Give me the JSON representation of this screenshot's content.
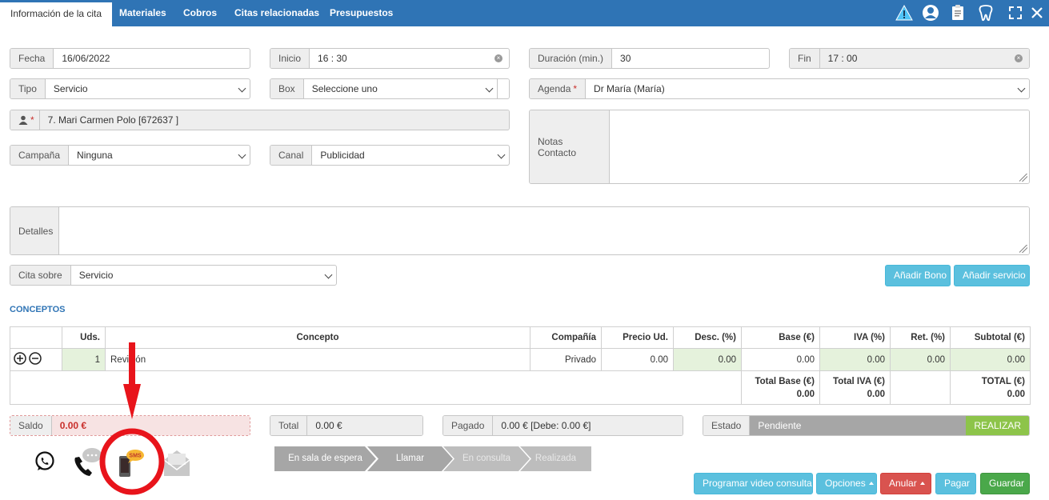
{
  "tabs": [
    {
      "label": "Información de la cita",
      "active": true
    },
    {
      "label": "Materiales"
    },
    {
      "label": "Cobros"
    },
    {
      "label": "Citas relacionadas"
    },
    {
      "label": "Presupuestos"
    }
  ],
  "icons": {
    "warning": "warning-icon",
    "user": "user-icon",
    "clipboard": "clipboard-icon",
    "tooth": "tooth-icon",
    "expand": "expand-icon",
    "close": "close-icon"
  },
  "form": {
    "fecha": {
      "label": "Fecha",
      "value": "16/06/2022"
    },
    "inicio": {
      "label": "Inicio",
      "value": "16 : 30"
    },
    "duracion": {
      "label": "Duración (min.)",
      "value": "30"
    },
    "fin": {
      "label": "Fin",
      "value": "17 : 00"
    },
    "tipo": {
      "label": "Tipo",
      "value": "Servicio"
    },
    "box": {
      "label": "Box",
      "value": "Seleccione uno"
    },
    "agenda": {
      "label": "Agenda",
      "value": "Dr María (María)"
    },
    "paciente": {
      "value": "7. Mari Carmen Polo [672637        ]"
    },
    "campana": {
      "label": "Campaña",
      "value": "Ninguna"
    },
    "canal": {
      "label": "Canal",
      "value": "Publicidad"
    },
    "notas": {
      "label": "Notas Contacto"
    },
    "detalles": {
      "label": "Detalles"
    },
    "cita_sobre": {
      "label": "Cita sobre",
      "value": "Servicio"
    }
  },
  "buttons": {
    "anadir_bono": "Añadir Bono",
    "anadir_servicio": "Añadir servicio",
    "programar": "Programar video consulta",
    "opciones": "Opciones",
    "anular": "Anular",
    "pagar": "Pagar",
    "guardar": "Guardar"
  },
  "conceptos": {
    "title": "CONCEPTOS",
    "headers": [
      "",
      "Uds.",
      "Concepto",
      "Compañía",
      "Precio Ud.",
      "Desc. (%)",
      "Base (€)",
      "IVA (%)",
      "Ret. (%)",
      "Subtotal (€)"
    ],
    "rows": [
      {
        "uds": "1",
        "concepto": "Revisión",
        "compania": "Privado",
        "precio": "0.00",
        "desc": "0.00",
        "base": "0.00",
        "iva": "0.00",
        "ret": "0.00",
        "subtotal": "0.00"
      }
    ],
    "totals": {
      "base_label": "Total Base (€)",
      "base_value": "0.00",
      "iva_label": "Total IVA (€)",
      "iva_value": "0.00",
      "total_label": "TOTAL (€)",
      "total_value": "0.00"
    }
  },
  "summary": {
    "saldo": {
      "label": "Saldo",
      "value": "0.00 €"
    },
    "total": {
      "label": "Total",
      "value": "0.00 €"
    },
    "pagado": {
      "label": "Pagado",
      "value": "0.00 € [Debe: 0.00 €]"
    },
    "estado": {
      "label": "Estado",
      "value": "Pendiente",
      "action": "REALIZAR"
    }
  },
  "workflow": [
    "En sala de espera",
    "Llamar",
    "En consulta",
    "Realizada"
  ],
  "contact": {
    "sms_badge": "SMS"
  },
  "colors": {
    "primary": "#2f74b5",
    "info": "#5bc0de",
    "danger": "#d9534f",
    "success": "#4aa84a",
    "annotation": "#e8141b"
  }
}
